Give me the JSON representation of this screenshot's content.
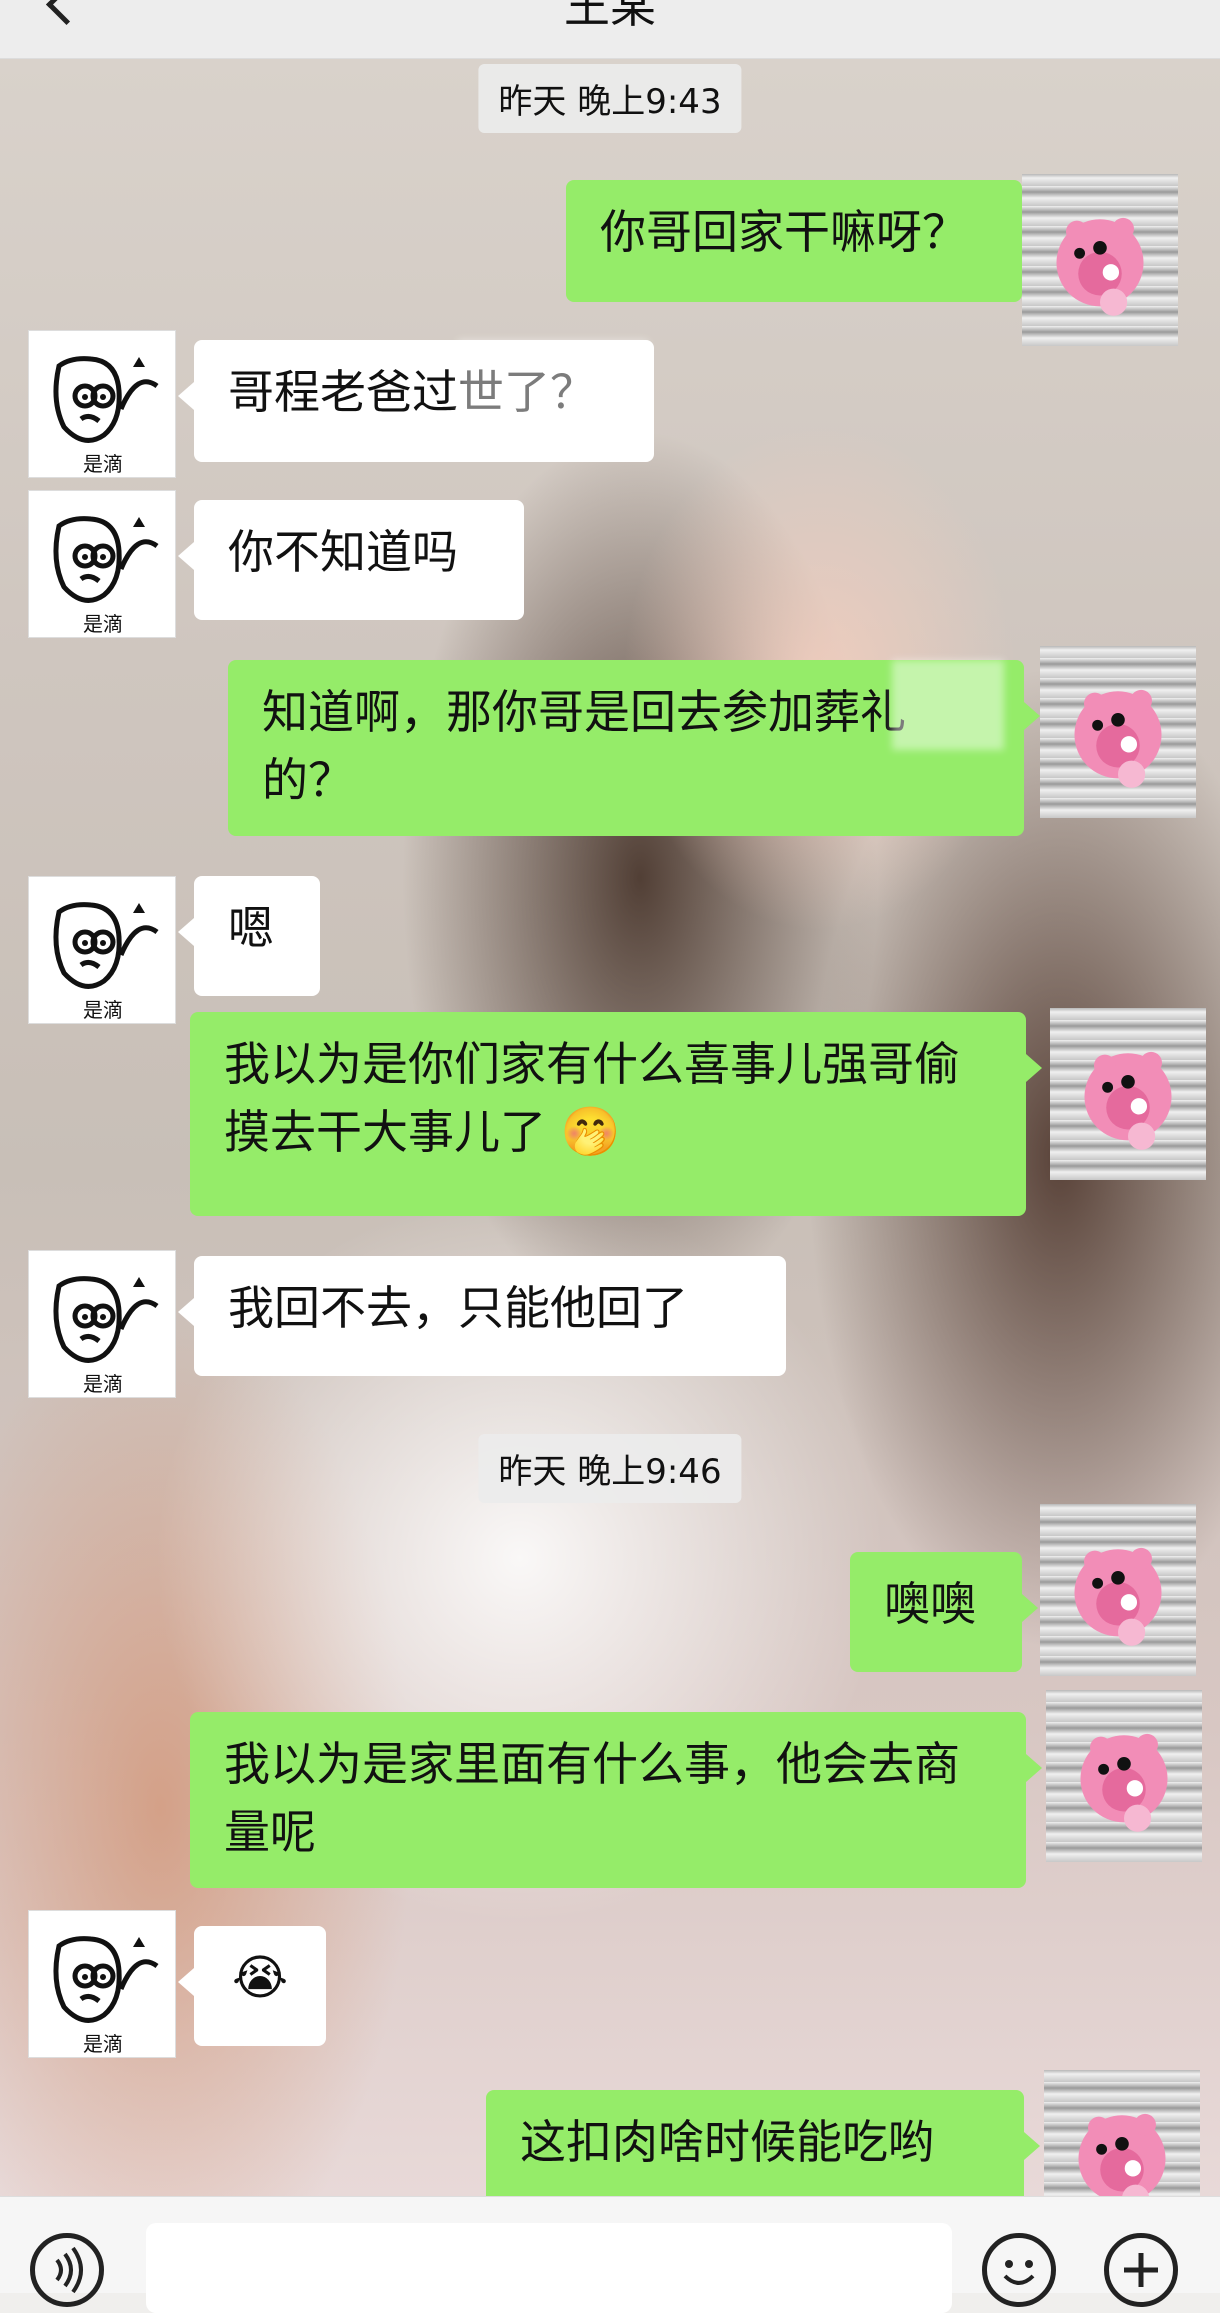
{
  "header": {
    "title": "王某"
  },
  "timestamps": [
    "昨天 晚上9:43",
    "昨天 晚上9:46"
  ],
  "messages": [
    {
      "side": "right",
      "text": "你哥回家干嘛呀？"
    },
    {
      "side": "left",
      "text": "哥程老爸过世了？"
    },
    {
      "side": "left",
      "text": "你不知道吗"
    },
    {
      "side": "right",
      "text": "知道啊，那你哥是回去参加葬礼的？"
    },
    {
      "side": "left",
      "text": "嗯"
    },
    {
      "side": "right",
      "text": "我以为是你们家有什么喜事儿强哥偷摸去干大事儿了",
      "emoji": "🤭"
    },
    {
      "side": "left",
      "text": "我回不去，只能他回了"
    },
    {
      "side": "right",
      "text": "噢噢"
    },
    {
      "side": "right",
      "text": "我以为是家里面有什么事，他会去商量呢"
    },
    {
      "side": "left",
      "text": "",
      "emoji": "😭"
    },
    {
      "side": "right",
      "text": "这扣肉啥时候能吃哟"
    }
  ],
  "avatar_left": {
    "label": "是滴"
  },
  "bottom": {
    "voice": "voice",
    "emoji_icon": "emoji-icon",
    "plus_icon": "plus-icon"
  }
}
